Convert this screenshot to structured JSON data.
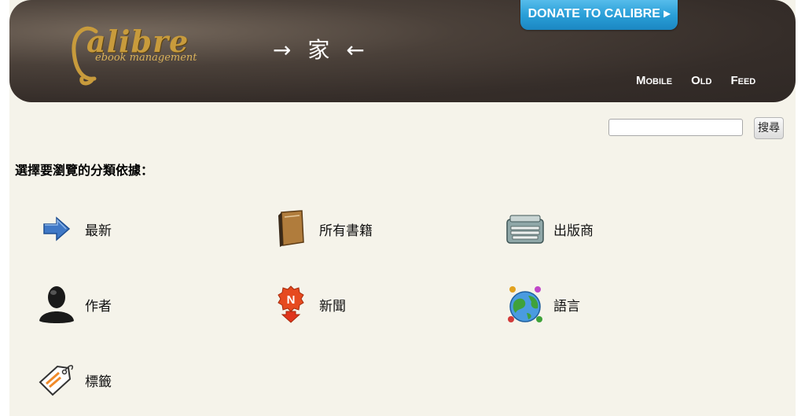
{
  "header": {
    "logo_text": "alibre",
    "logo_subtitle": "ebook management",
    "title": "→ 家 ←",
    "donate_label": "DONATE TO CALIBRE ▸",
    "links": [
      "Mobile",
      "Old",
      "Feed"
    ]
  },
  "search": {
    "value": "",
    "button_label": "搜尋"
  },
  "prompt": "選擇要瀏覽的分類依據：",
  "categories": [
    {
      "label": "最新",
      "icon": "arrow-right-icon"
    },
    {
      "label": "所有書籍",
      "icon": "book-icon"
    },
    {
      "label": "出版商",
      "icon": "typewriter-icon"
    },
    {
      "label": "作者",
      "icon": "person-icon"
    },
    {
      "label": "新聞",
      "icon": "news-icon"
    },
    {
      "label": "語言",
      "icon": "globe-icon"
    },
    {
      "label": "標籤",
      "icon": "tag-icon"
    }
  ],
  "colors": {
    "header_bg": "#352d29",
    "page_bg": "#f5f3ea",
    "donate_blue": "#2a9fd8",
    "logo_gold": "#c89b3c"
  }
}
